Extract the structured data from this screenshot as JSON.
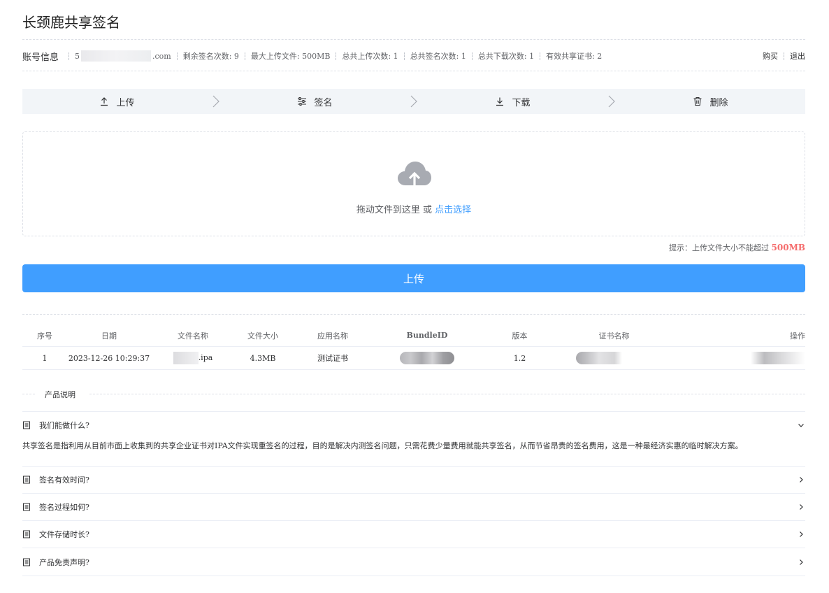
{
  "page": {
    "title": "长颈鹿共享签名"
  },
  "account": {
    "label": "账号信息",
    "email_prefix": "5",
    "email_suffix": ".com",
    "remaining_signs": "剩余签名次数: 9",
    "max_upload": "最大上传文件: 500MB",
    "total_uploads": "总共上传次数: 1",
    "total_signs": "总共签名次数: 1",
    "total_downloads": "总共下载次数: 1",
    "valid_certs": "有效共享证书: 2",
    "buy": "购买",
    "logout": "退出"
  },
  "steps": [
    {
      "label": "上传",
      "icon": "upload-icon"
    },
    {
      "label": "签名",
      "icon": "sliders-icon"
    },
    {
      "label": "下载",
      "icon": "download-icon"
    },
    {
      "label": "删除",
      "icon": "trash-icon"
    }
  ],
  "dropzone": {
    "text": "拖动文件到这里 或",
    "pick": "点击选择"
  },
  "hint": {
    "prefix": "提示：上传文件大小不能超过",
    "limit": "500MB"
  },
  "upload_button": "上传",
  "table": {
    "headers": [
      "序号",
      "日期",
      "文件名称",
      "文件大小",
      "应用名称",
      "BundleID",
      "版本",
      "证书名称",
      "操作"
    ],
    "rows": [
      {
        "index": "1",
        "date": "2023-12-26 10:29:37",
        "file_ext": ".ipa",
        "size": "4.3MB",
        "app": "测试证书",
        "version": "1.2"
      }
    ]
  },
  "section": {
    "title": "产品说明"
  },
  "faq": [
    {
      "q": "我们能做什么?",
      "open": true,
      "a": "共享签名是指利用从目前市面上收集到的共享企业证书对IPA文件实现重签名的过程，目的是解决内测签名问题，只需花费少量费用就能共享签名，从而节省昂贵的签名费用，这是一种最经济实惠的临时解决方案。"
    },
    {
      "q": "签名有效时间?",
      "open": false
    },
    {
      "q": "签名过程如何?",
      "open": false
    },
    {
      "q": "文件存储时长?",
      "open": false
    },
    {
      "q": "产品免责声明?",
      "open": false
    }
  ],
  "colors": {
    "primary": "#409eff",
    "danger": "#f56c6c",
    "step_bg": "#f2f5f8"
  }
}
